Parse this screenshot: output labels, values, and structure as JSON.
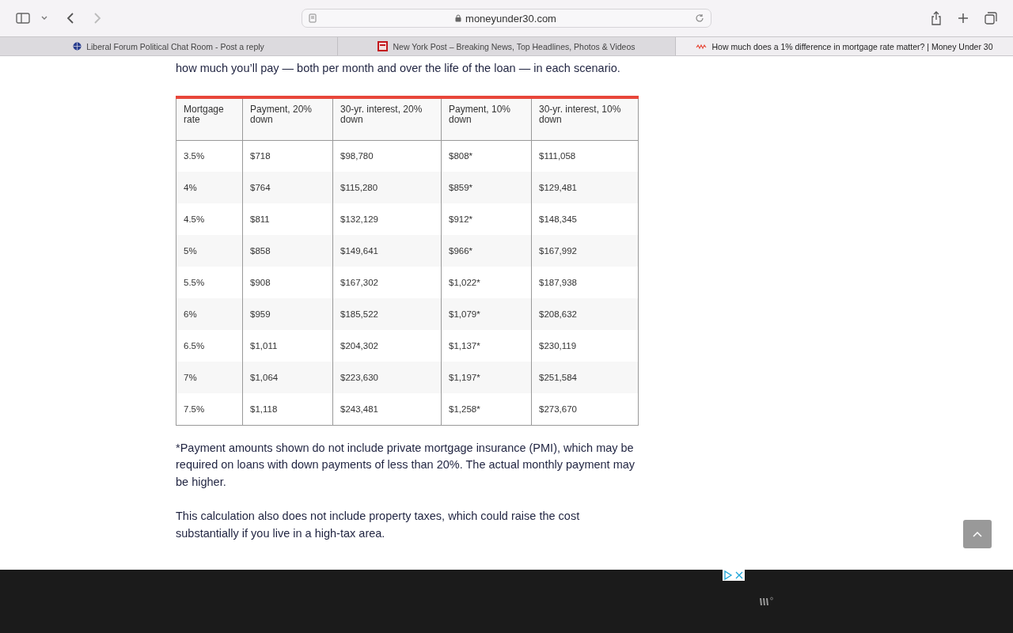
{
  "browser": {
    "address": "moneyunder30.com"
  },
  "tabs": [
    {
      "title": "Liberal Forum Political Chat Room - Post a reply",
      "selected": false
    },
    {
      "title": "New York Post – Breaking News, Top Headlines, Photos & Videos",
      "selected": false
    },
    {
      "title": "How much does a 1% difference in mortgage rate matter? | Money Under 30",
      "selected": true
    }
  ],
  "article": {
    "intro": "how much you’ll pay — both per month and over the life of the loan — in each scenario.",
    "table": {
      "columns": [
        "Mortgage rate",
        "Payment, 20% down",
        "30-yr. interest, 20% down",
        "Payment, 10% down",
        "30-yr. interest, 10% down"
      ],
      "rows": [
        [
          "3.5%",
          "$718",
          "$98,780",
          "$808*",
          "$111,058"
        ],
        [
          "4%",
          "$764",
          "$115,280",
          "$859*",
          "$129,481"
        ],
        [
          "4.5%",
          "$811",
          "$132,129",
          "$912*",
          "$148,345"
        ],
        [
          "5%",
          "$858",
          "$149,641",
          "$966*",
          "$167,992"
        ],
        [
          "5.5%",
          "$908",
          "$167,302",
          "$1,022*",
          "$187,938"
        ],
        [
          "6%",
          "$959",
          "$185,522",
          "$1,079*",
          "$208,632"
        ],
        [
          "6.5%",
          "$1,011",
          "$204,302",
          "$1,137*",
          "$230,119"
        ],
        [
          "7%",
          "$1,064",
          "$223,630",
          "$1,197*",
          "$251,584"
        ],
        [
          "7.5%",
          "$1,118",
          "$243,481",
          "$1,258*",
          "$273,670"
        ]
      ]
    },
    "paragraphs": [
      "*Payment amounts shown do not include private mortgage insurance (PMI), which may be required on loans with down payments of less than 20%. The actual monthly payment may be higher.",
      "This calculation also does not include property taxes, which could raise the cost substantially if you live in a high-tax area."
    ]
  }
}
